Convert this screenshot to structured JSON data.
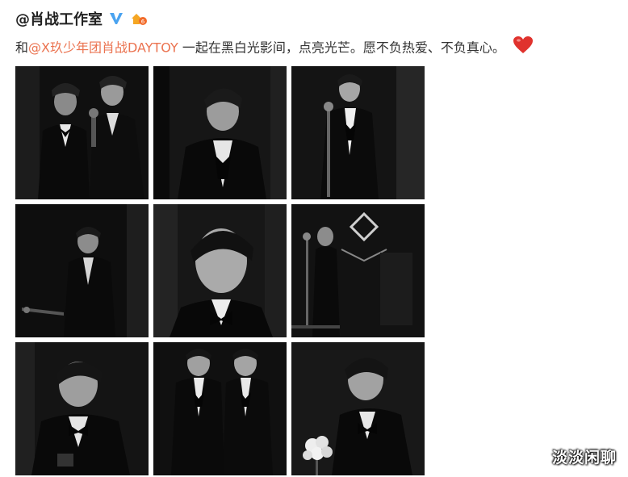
{
  "post": {
    "author": "@肖战工作室",
    "text_prefix": "和",
    "mention": "@X玖少年团肖战DAYTOY",
    "text_suffix": " 一起在黑白光影间，点亮光芒。愿不负热爱、不负真心。",
    "emoji": "heart-icon"
  },
  "photos": [
    {
      "label": "photo-1"
    },
    {
      "label": "photo-2"
    },
    {
      "label": "photo-3"
    },
    {
      "label": "photo-4"
    },
    {
      "label": "photo-5"
    },
    {
      "label": "photo-6"
    },
    {
      "label": "photo-7"
    },
    {
      "label": "photo-8"
    },
    {
      "label": "photo-9"
    }
  ],
  "watermark": "淡淡闲聊",
  "colors": {
    "mention": "#eb7350",
    "verified": "#4aa3f0",
    "heart": "#e0322d",
    "badge": "#f5a623"
  }
}
